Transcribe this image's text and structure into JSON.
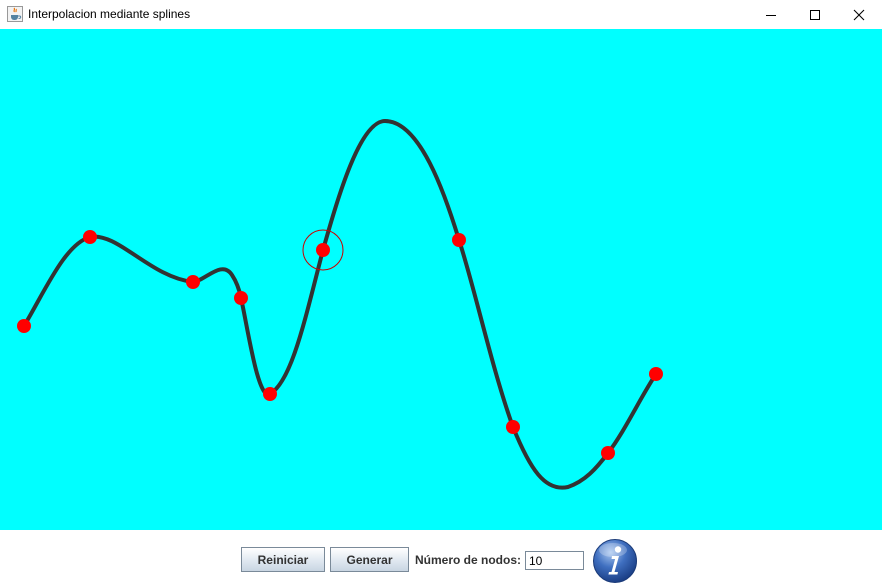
{
  "window": {
    "title": "Interpolacion mediante splines",
    "icon": "java-cup-icon",
    "controls": [
      "minimize",
      "maximize",
      "close"
    ]
  },
  "canvas": {
    "background": "#00ffff",
    "curve_color": "#333333",
    "node_color": "#ff0000",
    "selection_ring_color": "#cc0000",
    "nodes": [
      {
        "index": 0,
        "selected": false
      },
      {
        "index": 1,
        "selected": false
      },
      {
        "index": 2,
        "selected": false
      },
      {
        "index": 3,
        "selected": false
      },
      {
        "index": 4,
        "selected": false
      },
      {
        "index": 5,
        "selected": true
      },
      {
        "index": 6,
        "selected": false
      },
      {
        "index": 7,
        "selected": false
      },
      {
        "index": 8,
        "selected": false
      },
      {
        "index": 9,
        "selected": false
      }
    ]
  },
  "controls": {
    "reset_label": "Reiniciar",
    "generate_label": "Generar",
    "nodes_label": "Número de nodos:",
    "nodes_value": "10",
    "info_icon": "info-icon"
  }
}
